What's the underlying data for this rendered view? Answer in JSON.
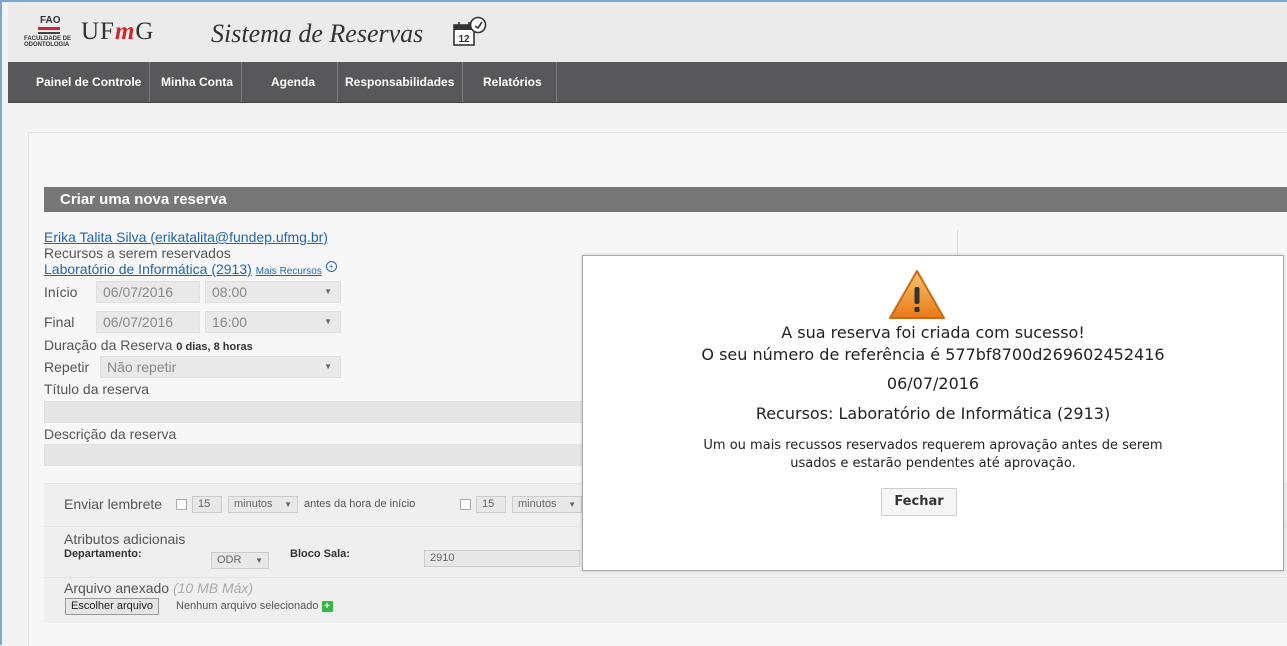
{
  "header": {
    "logo_fao": "FAO",
    "logo_faculty": "FACULDADE DE ODONTOLOGIA",
    "logo_ufmg_a": "UF",
    "logo_ufmg_m": "m",
    "logo_ufmg_b": "G",
    "app_title": "Sistema de Reservas",
    "calendar_day": "12"
  },
  "nav": {
    "items": [
      "Painel de Controle",
      "Minha Conta",
      "Agenda",
      "Responsabilidades",
      "Relatórios"
    ]
  },
  "form": {
    "section_title": "Criar uma nova reserva",
    "user_link": "Erika Talita Silva (erikatalita@fundep.ufmg.br)",
    "resources_label": "Recursos a serem reservados",
    "resource_link": "Laboratório de Informática (2913)",
    "more_resources": "Mais Recursos",
    "start_label": "Início",
    "start_date": "06/07/2016",
    "start_time": "08:00",
    "end_label": "Final",
    "end_date": "06/07/2016",
    "end_time": "16:00",
    "duration_label": "Duração da Reserva",
    "duration_value": "0 dias, 8 horas",
    "repeat_label": "Repetir",
    "repeat_value": "Não repetir",
    "title_label": "Título da reserva",
    "description_label": "Descrição da reserva",
    "reminder_label": "Enviar lembrete",
    "reminder_value1": "15",
    "reminder_unit1": "minutos",
    "reminder_before": "antes da hora de início",
    "reminder_value2": "15",
    "reminder_unit2": "minutos",
    "attributes_label": "Atributos adicionais",
    "department_label": "Departamento:",
    "department_value": "ODR",
    "block_label": "Bloco Sala:",
    "block_value": "2910",
    "attachment_label": "Arquivo anexado",
    "attachment_max": "(10 MB Máx)",
    "choose_file": "Escolher arquivo",
    "no_file": "Nenhum arquivo selecionado"
  },
  "modal": {
    "line1": "A sua reserva foi criada com sucesso!",
    "line2": "O seu número de referência é 577bf8700d269602452416",
    "date": "06/07/2016",
    "resources": "Recursos: Laboratório de Informática (2913)",
    "note1": "Um ou mais recussos reservados requerem aprovação antes de serem",
    "note2": "usados e estarão pendentes até aprovação.",
    "close_button": "Fechar"
  },
  "colors": {
    "navbar": "#58585a",
    "section_header": "#777777",
    "link": "#2266aa",
    "warning": "#f39a2d",
    "logo_red": "#c8282d"
  },
  "icons": {
    "warning": "warning-triangle-icon",
    "calendar": "calendar-clock-icon",
    "add": "plus-icon",
    "more": "circle-plus-icon"
  }
}
